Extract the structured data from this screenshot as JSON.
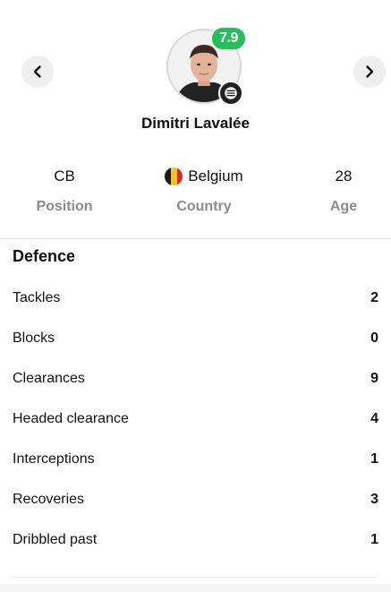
{
  "nav": {
    "prev_icon": "chevron-left-icon",
    "next_icon": "chevron-right-icon"
  },
  "player": {
    "name": "Dimitri Lavalée",
    "rating": "7.9",
    "rating_color": "#22bf5a"
  },
  "info": {
    "position": {
      "value": "CB",
      "label": "Position"
    },
    "country": {
      "value": "Belgium",
      "label": "Country",
      "flag_colors": [
        "#1a1a1a",
        "#f5c518",
        "#e0242b"
      ]
    },
    "age": {
      "value": "28",
      "label": "Age"
    }
  },
  "section": {
    "title": "Defence",
    "stats": [
      {
        "label": "Tackles",
        "value": "2"
      },
      {
        "label": "Blocks",
        "value": "0"
      },
      {
        "label": "Clearances",
        "value": "9"
      },
      {
        "label": "Headed clearance",
        "value": "4"
      },
      {
        "label": "Interceptions",
        "value": "1"
      },
      {
        "label": "Recoveries",
        "value": "3"
      },
      {
        "label": "Dribbled past",
        "value": "1"
      }
    ]
  }
}
